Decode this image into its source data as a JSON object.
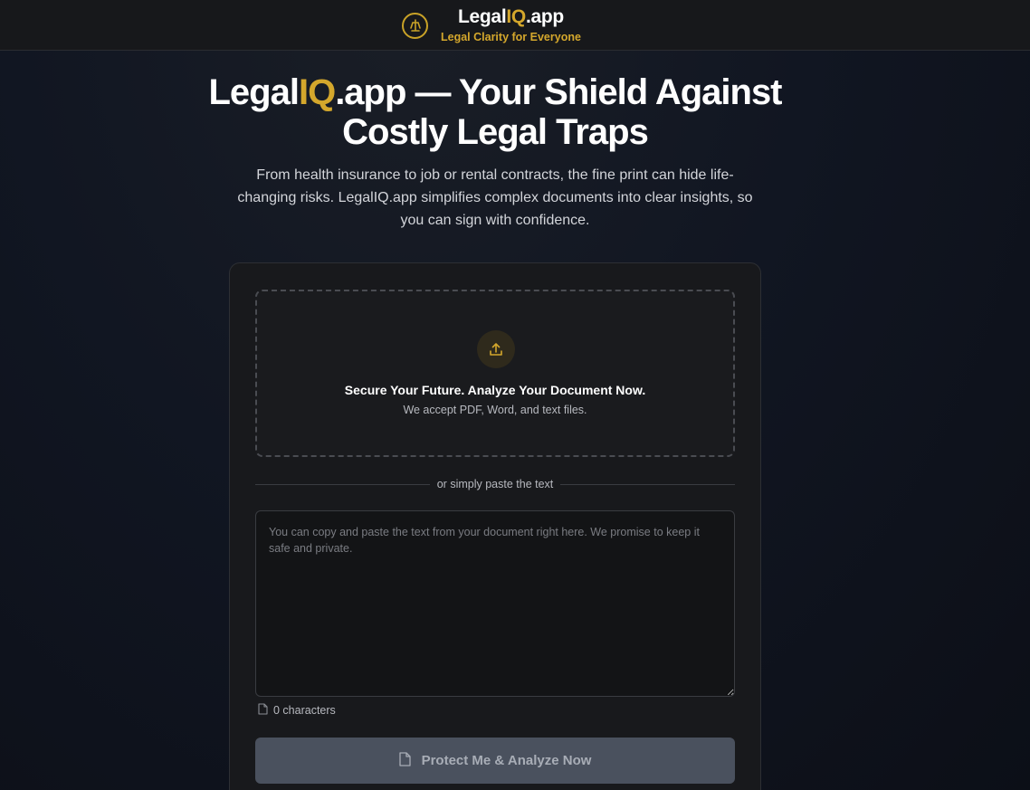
{
  "header": {
    "brand_prefix": "Legal",
    "brand_accent": "IQ",
    "brand_suffix": ".app",
    "tagline": "Legal Clarity for Everyone",
    "logo_icon": "scales-logo-icon"
  },
  "hero": {
    "title_prefix": "Legal",
    "title_accent": "IQ",
    "title_suffix": ".app — Your Shield Against Costly Legal Traps",
    "subtitle": "From health insurance to job or rental contracts, the fine print can hide life-changing risks. LegalIQ.app simplifies complex documents into clear insights, so you can sign with confidence."
  },
  "upload": {
    "icon": "upload-icon",
    "title": "Secure Your Future. Analyze Your Document Now.",
    "subtitle": "We accept PDF, Word, and text files."
  },
  "divider": {
    "label": "or simply paste the text"
  },
  "paste": {
    "value": "",
    "placeholder": "You can copy and paste the text from your document right here. We promise to keep it safe and private."
  },
  "char_count": {
    "icon": "document-icon",
    "label": "0 characters"
  },
  "analyze_button": {
    "icon": "document-icon",
    "label": "Protect Me & Analyze Now"
  },
  "colors": {
    "accent": "#d4a72c",
    "background": "#111622",
    "card": "#18191c",
    "button_disabled": "#4a515e"
  }
}
